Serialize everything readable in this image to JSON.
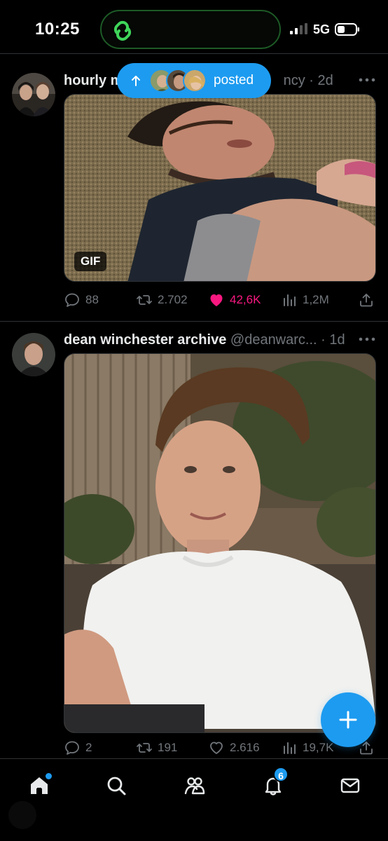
{
  "status_bar": {
    "time": "10:25",
    "network": "5G",
    "island_app_icon": "link-rings-icon",
    "accent": "#3fd55a"
  },
  "posted_pill": {
    "label": "posted",
    "arrow_icon": "arrow-up-icon"
  },
  "tweets": [
    {
      "display_name": "hourly m",
      "handle": "ncy",
      "age": "2d",
      "media_badge": "GIF",
      "stats": {
        "replies": "88",
        "reposts": "2.702",
        "likes": "42,6K",
        "views": "1,2M"
      },
      "liked": true
    },
    {
      "display_name": "dean winchester archive",
      "handle": "@deanwarc...",
      "age": "1d",
      "stats": {
        "replies": "2",
        "reposts": "191",
        "likes": "2.616",
        "views": "19,7K"
      },
      "liked": false
    }
  ],
  "nav": {
    "items": [
      "home-icon",
      "search-icon",
      "communities-icon",
      "notifications-icon",
      "messages-icon"
    ],
    "notifications_badge": "6"
  },
  "colors": {
    "accent": "#1d9bf0",
    "like": "#f91880",
    "muted": "#71767b",
    "divider": "#2f3336"
  }
}
